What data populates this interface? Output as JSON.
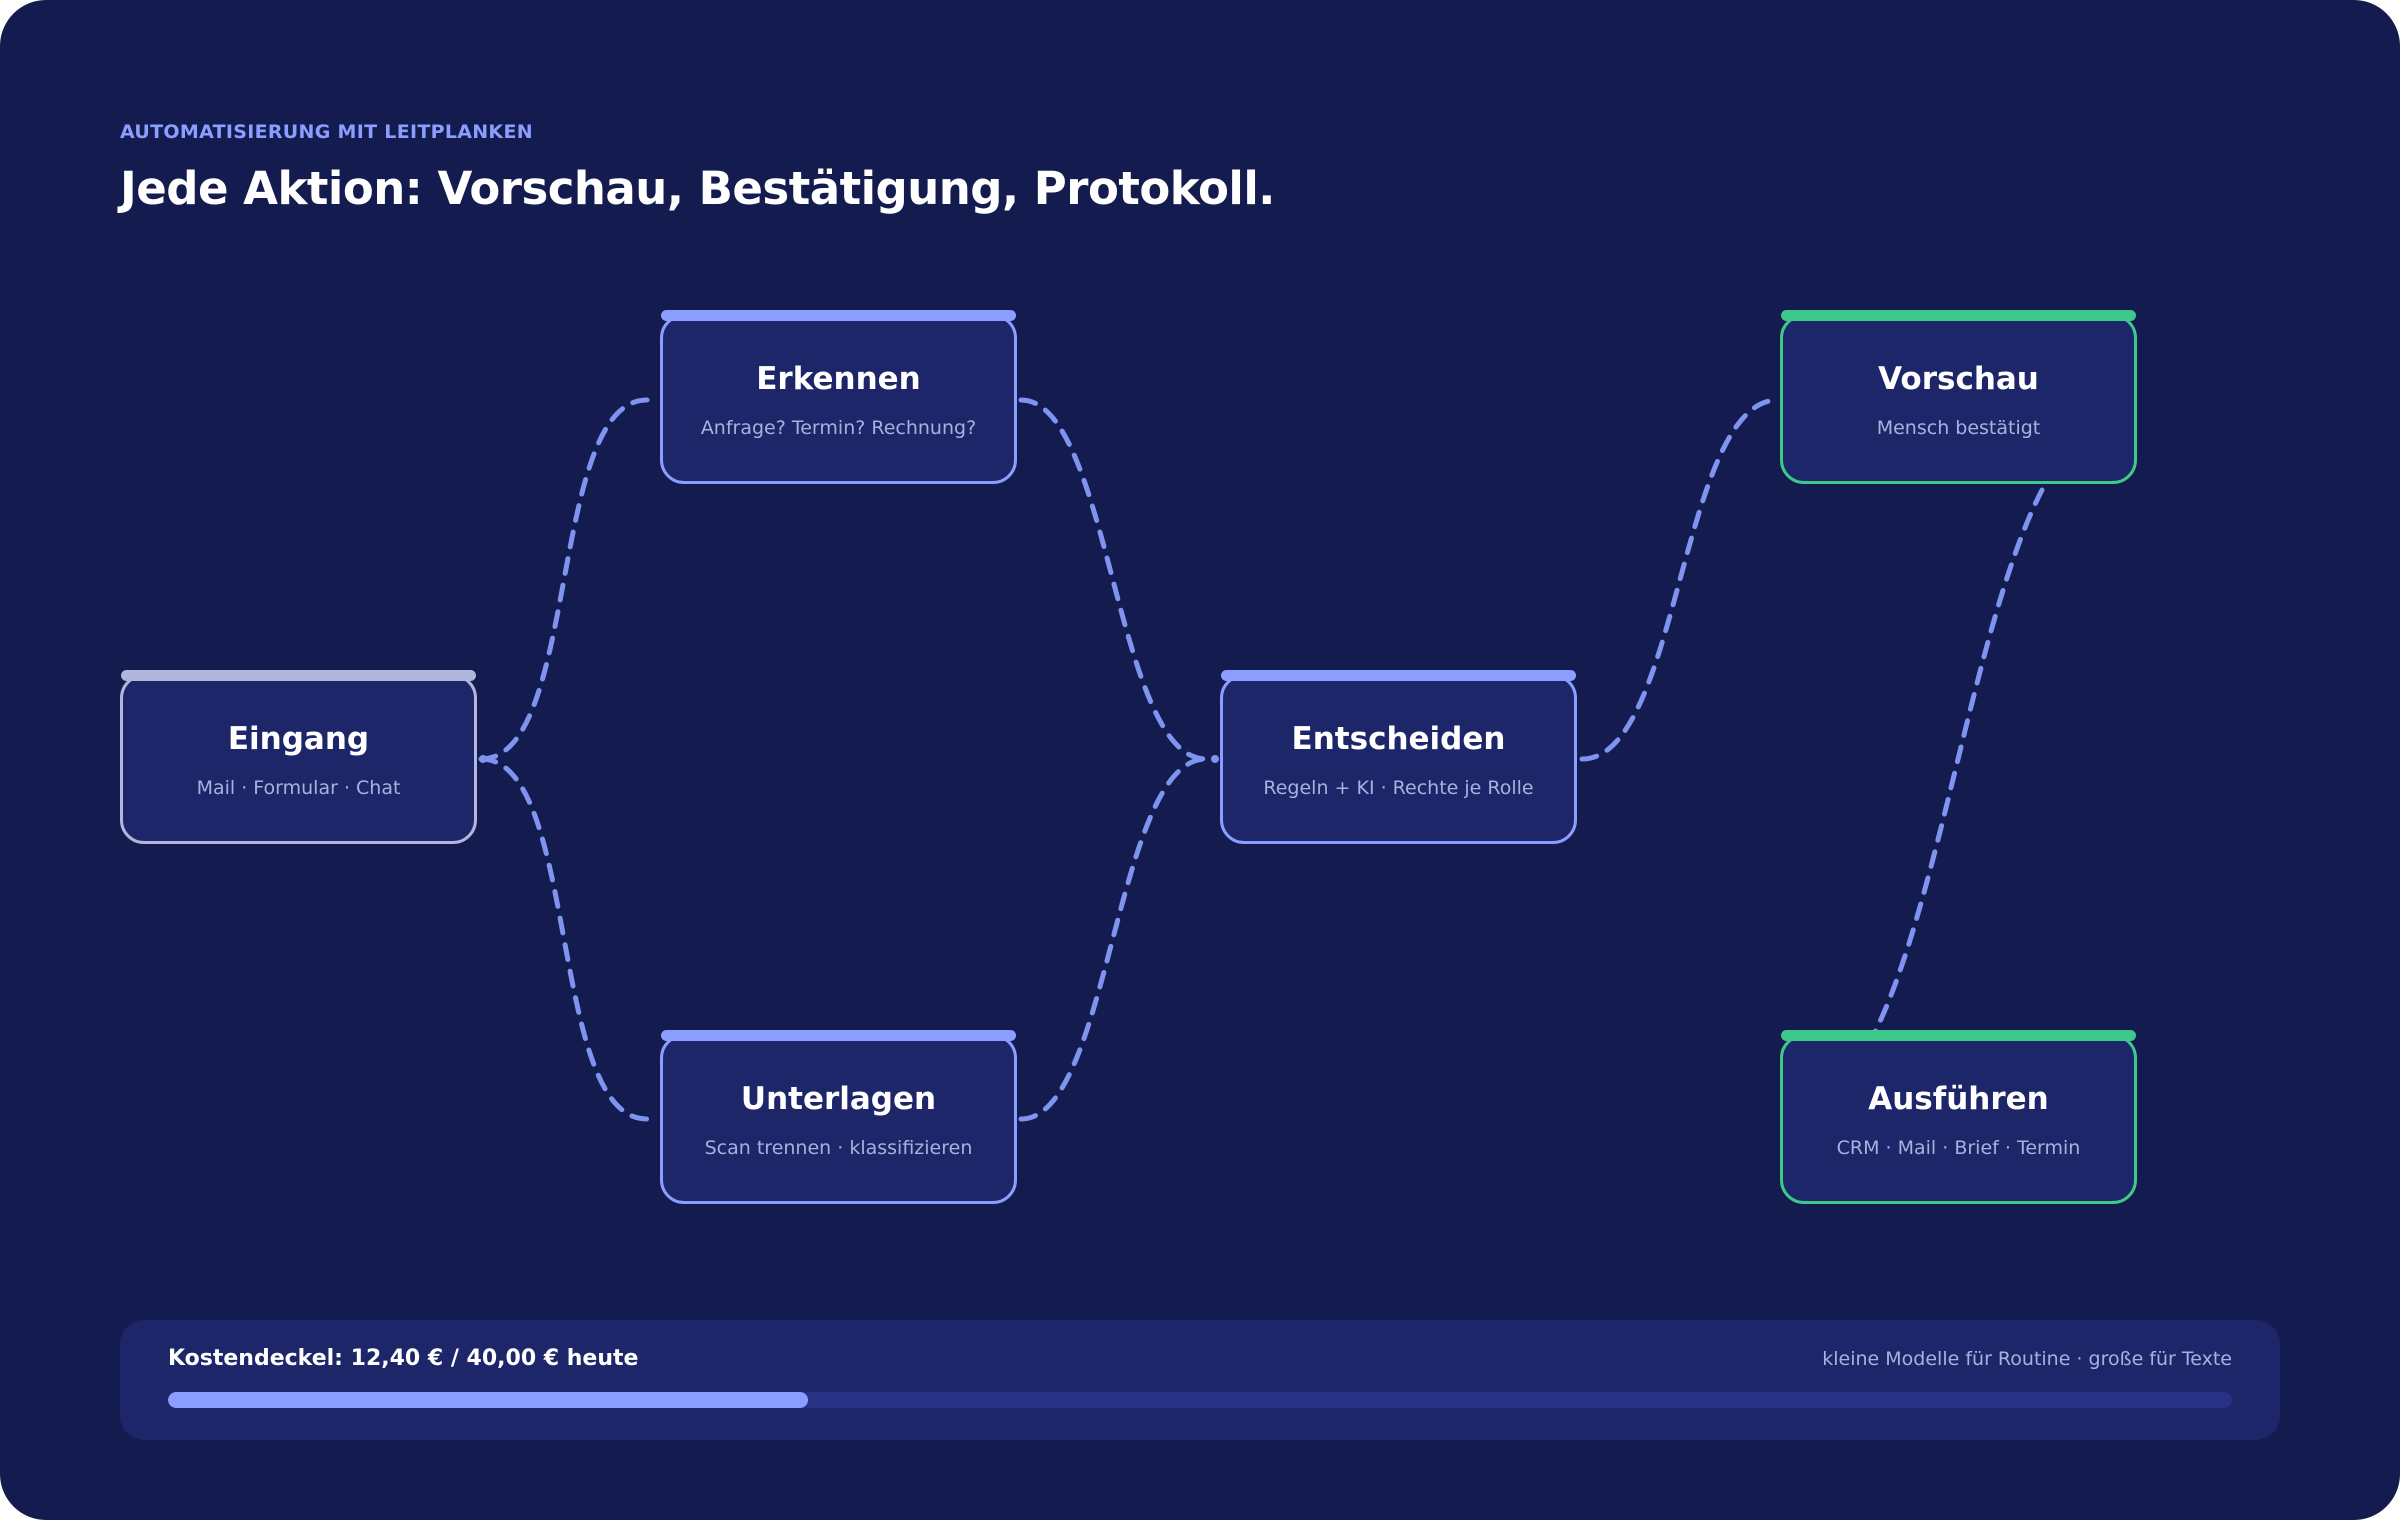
{
  "header": {
    "eyebrow": "AUTOMATISIERUNG MIT LEITPLANKEN",
    "title": "Jede Aktion: Vorschau, Bestätigung, Protokoll."
  },
  "nodes": {
    "eingang": {
      "title": "Eingang",
      "subtitle": "Mail · Formular · Chat"
    },
    "erkennen": {
      "title": "Erkennen",
      "subtitle": "Anfrage? Termin? Rechnung?"
    },
    "unterlagen": {
      "title": "Unterlagen",
      "subtitle": "Scan trennen · klassifizieren"
    },
    "entscheiden": {
      "title": "Entscheiden",
      "subtitle": "Regeln + KI · Rechte je Rolle"
    },
    "vorschau": {
      "title": "Vorschau",
      "subtitle": "Mensch bestätigt"
    },
    "ausfuehren": {
      "title": "Ausführen",
      "subtitle": "CRM · Mail · Brief · Termin"
    }
  },
  "edges": [
    {
      "from": "eingang",
      "to": "erkennen"
    },
    {
      "from": "eingang",
      "to": "unterlagen"
    },
    {
      "from": "erkennen",
      "to": "entscheiden"
    },
    {
      "from": "unterlagen",
      "to": "entscheiden"
    },
    {
      "from": "entscheiden",
      "to": "vorschau"
    },
    {
      "from": "vorschau",
      "to": "ausfuehren"
    }
  ],
  "budget": {
    "label": "Kostendeckel: 12,40 € / 40,00 € heute",
    "spent": 12.4,
    "cap": 40.0,
    "note": "kleine Modelle für Routine · große für Texte"
  },
  "colors": {
    "background": "#141c4f",
    "card": "#1e266a",
    "accent": "#8b9eff",
    "neutral": "#b1b7da",
    "green": "#3ec889",
    "edge": "#7f93f0"
  }
}
